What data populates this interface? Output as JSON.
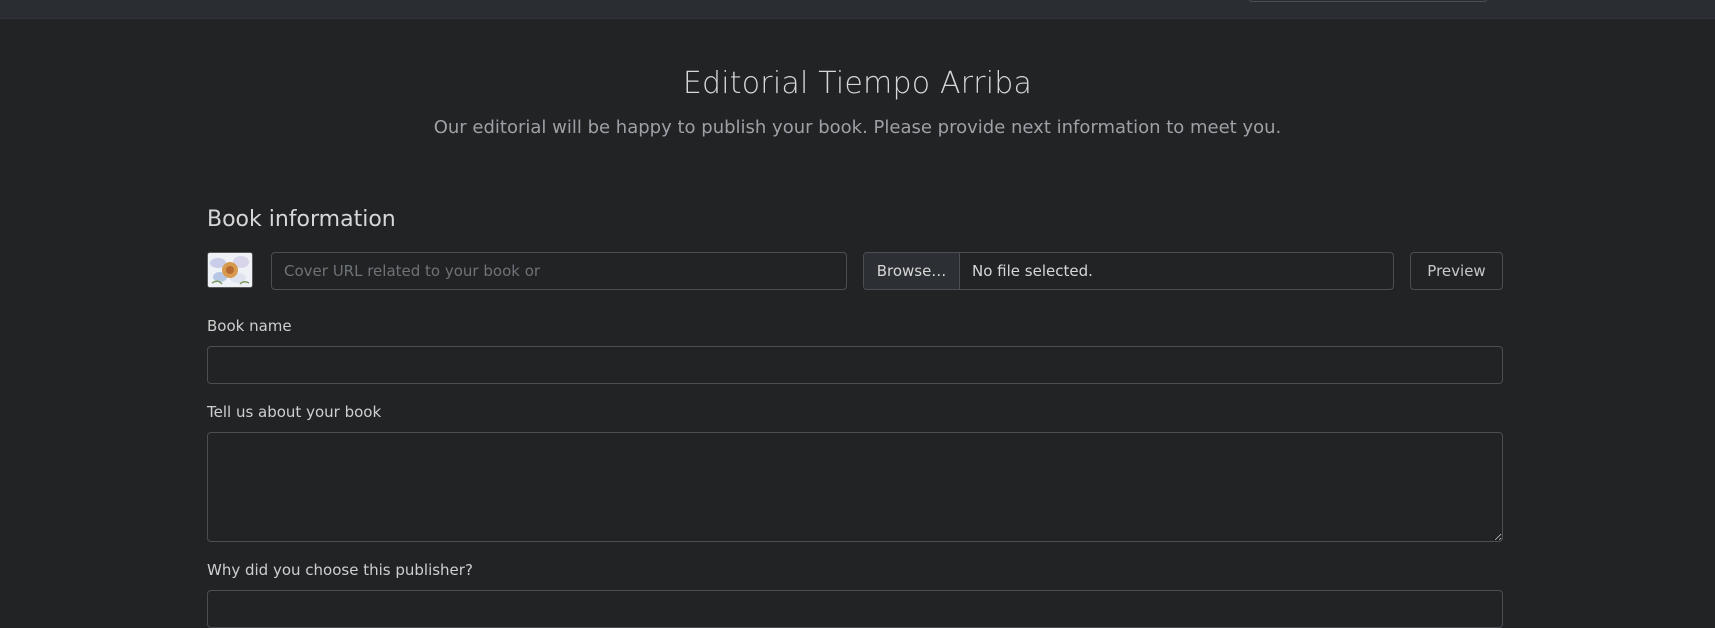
{
  "header": {
    "title": "Editorial Tiempo Arriba",
    "subtitle": "Our editorial will be happy to publish your book. Please provide next information to meet you."
  },
  "book_info": {
    "section_title": "Book information",
    "cover": {
      "thumbnail_icon": "flower-image-icon",
      "url_placeholder": "Cover URL related to your book or",
      "browse_label": "Browse…",
      "file_status": "No file selected.",
      "preview_label": "Preview"
    },
    "book_name": {
      "label": "Book name",
      "value": ""
    },
    "about": {
      "label": "Tell us about your book",
      "value": ""
    },
    "why_publisher": {
      "label": "Why did you choose this publisher?",
      "value": ""
    }
  },
  "colors": {
    "background": "#212325",
    "topbar": "#2a2d31",
    "border": "#4b4f54",
    "text": "#d7d7d7",
    "muted_text": "#9da1a6"
  }
}
